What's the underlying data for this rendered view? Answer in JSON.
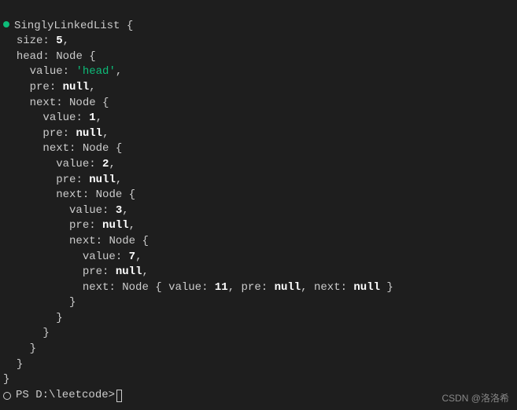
{
  "output": {
    "class_name": "SinglyLinkedList",
    "node_name": "Node",
    "size_key": "size",
    "size_val": "5",
    "head_key": "head",
    "value_key": "value",
    "pre_key": "pre",
    "next_key": "next",
    "null_val": "null",
    "head_val": "'head'",
    "v1": "1",
    "v2": "2",
    "v3": "3",
    "v4": "7",
    "v5": "11",
    "comma": ",",
    "open": "{",
    "close": "}",
    "colon": ":"
  },
  "prompt": {
    "text": "PS D:\\leetcode>"
  },
  "watermark": "CSDN @洛洛希"
}
